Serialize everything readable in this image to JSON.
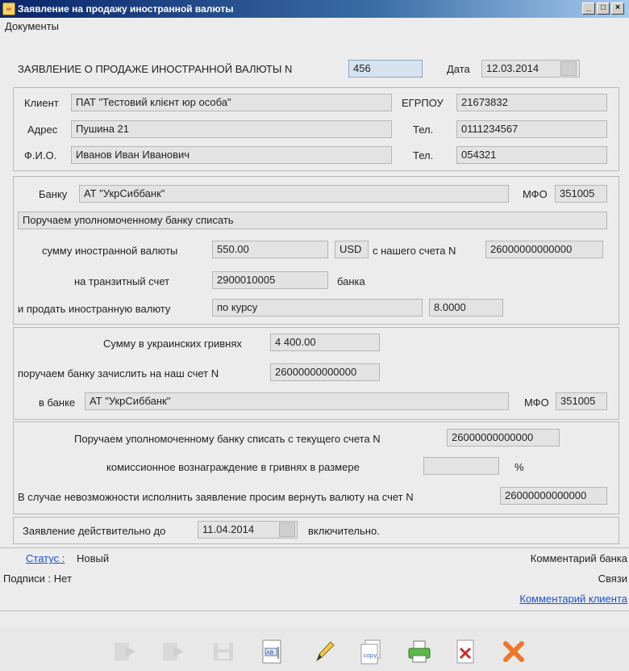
{
  "window": {
    "title": "Заявление на продажу иностранной валюты"
  },
  "menu": {
    "documents": "Документы"
  },
  "header": {
    "label": "ЗАЯВЛЕНИЕ О ПРОДАЖЕ ИНОСТРАННОЙ ВАЛЮТЫ N",
    "number": "456",
    "date_label": "Дата",
    "date": "12.03.2014"
  },
  "client": {
    "client_label": "Клиент",
    "client_value": "ПАТ \"Тестовий клієнт юр особа\"",
    "egrpou_label": "ЕГРПОУ",
    "egrpou_value": "21673832",
    "address_label": "Адрес",
    "address_value": "Пушина 21",
    "phone1_label": "Тел.",
    "phone1_value": "0111234567",
    "fio_label": "Ф.И.О.",
    "fio_value": "Иванов Иван Иванович",
    "phone2_label": "Тел.",
    "phone2_value": "054321"
  },
  "bank": {
    "bank_label": "Банку",
    "bank_value": "АТ \"УкрСиббанк\"",
    "mfo_label": "МФО",
    "mfo_value": "351005",
    "instruction": "Поручаем уполномоченному банку списать",
    "amount_label": "сумму иностранной валюты",
    "amount_value": "550.00",
    "currency": "USD",
    "from_account_label": "с нашего  счета N",
    "from_account_value": "26000000000000",
    "transit_label": "на транзитный счет",
    "transit_value": "2900010005",
    "transit_bank_label": "банка",
    "sell_label": "и продать иностранную валюту",
    "rate_type": "по курсу",
    "rate_value": "8.0000"
  },
  "uah": {
    "sum_label": "Сумму в украинских гривнях",
    "sum_value": "4 400.00",
    "credit_label": "поручаем банку зачислить на наш  счет N",
    "credit_value": "26000000000000",
    "bank_label": "в банке",
    "bank_value": "АТ \"УкрСиббанк\"",
    "mfo_label": "МФО",
    "mfo_value": "351005"
  },
  "commission": {
    "debit_label": "Поручаем уполномоченному банку списать с текущего  счета N",
    "debit_value": "26000000000000",
    "fee_label": "комиссионное вознаграждение в гривнях в размере",
    "fee_value": "",
    "percent": "%",
    "refund_label": "В случае невозможности исполнить заявление просим вернуть валюту на счет N",
    "refund_value": "26000000000000"
  },
  "validity": {
    "label": "Заявление действительно до",
    "date": "11.04.2014",
    "suffix": "включительно."
  },
  "status": {
    "status_link": "Статус :",
    "status_value": "Новый",
    "signatures_label": "Подписи : Нет",
    "bank_comment": "Комментарий банка",
    "links": "Связи",
    "client_comment": "Комментарий клиента"
  },
  "icons": {
    "send": "arrow-right-icon",
    "forward": "arrow-right-icon",
    "save": "save-icon",
    "edit_text": "edit-text-icon",
    "pen": "pen-icon",
    "copy": "copy-icon",
    "print": "printer-icon",
    "delete": "delete-icon",
    "close": "close-icon"
  },
  "colors": {
    "accent_link": "#1a4fd6",
    "delete_red": "#d12a2a",
    "close_orange": "#f0772a"
  }
}
